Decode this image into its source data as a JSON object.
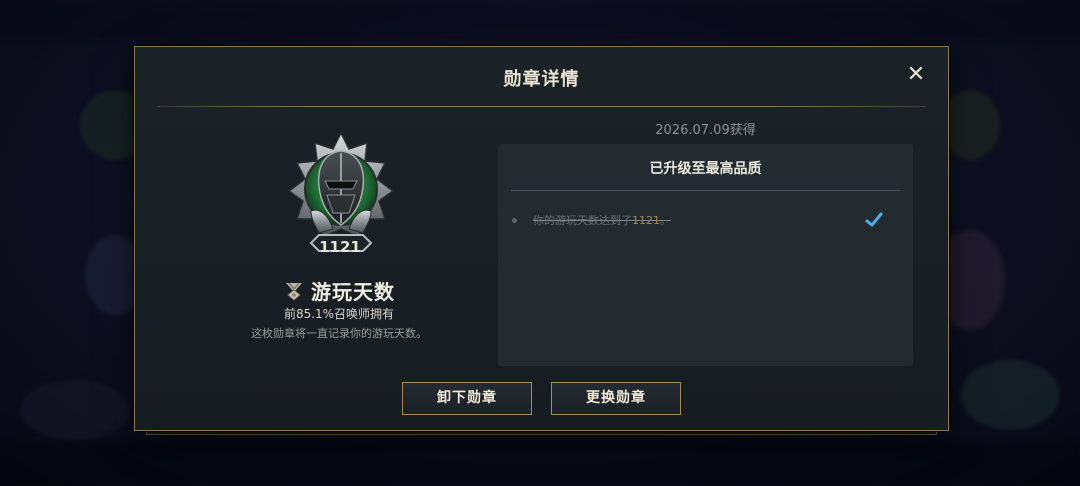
{
  "dialog": {
    "title": "勋章详情",
    "close_icon": "close-icon"
  },
  "badge": {
    "level": "1121",
    "name": "游玩天数",
    "name_icon": "medal-icon",
    "rarity": "前85.1%召唤师拥有",
    "description": "这枚勋章将一直记录你的游玩天数。"
  },
  "progress": {
    "obtained_date": "2026.07.09获得",
    "panel_title": "已升级至最高品质",
    "requirement_prefix": "你的游玩天数达到了",
    "requirement_value": "1121",
    "requirement_suffix": "。",
    "completed_icon": "checkmark-icon"
  },
  "buttons": {
    "unequip": "卸下勋章",
    "replace": "更换勋章"
  },
  "colors": {
    "gold_border": "#8a7a4c",
    "panel_bg": "#232b31",
    "check_blue": "#4ab0e8"
  }
}
